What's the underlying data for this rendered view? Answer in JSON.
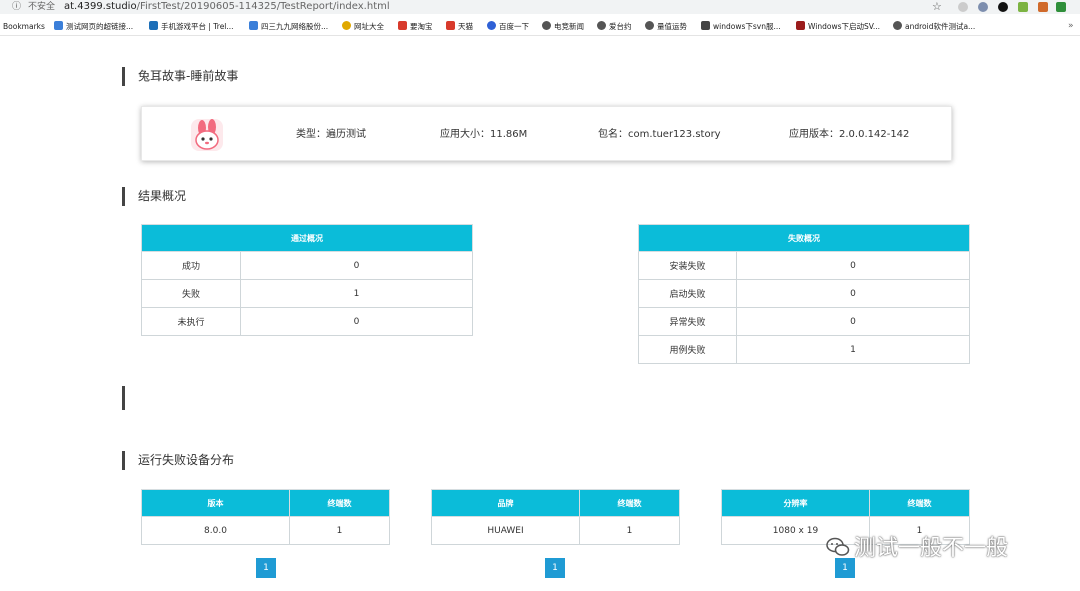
{
  "browser": {
    "security_label": "不安全",
    "url_host": "at.4399.studio",
    "url_path": "/FirstTest/20190605-114325/TestReport/index.html",
    "bookmarks_label": "Bookmarks",
    "bookmarks": [
      {
        "label": "测试网页的超链接...",
        "color": "#3b7fd9"
      },
      {
        "label": "手机游戏平台 | Trel...",
        "color": "#1d6fb8"
      },
      {
        "label": "四三九九网络股份...",
        "color": "#3b7fd9"
      },
      {
        "label": "网址大全",
        "color": "#e0a800"
      },
      {
        "label": "要淘宝",
        "color": "#d83a2c"
      },
      {
        "label": "天猫",
        "color": "#d83a2c"
      },
      {
        "label": "百度一下",
        "color": "#2f61d6"
      },
      {
        "label": "电竞新闻",
        "color": "#555555"
      },
      {
        "label": "爱台约",
        "color": "#555555"
      },
      {
        "label": "量值运势",
        "color": "#555555"
      },
      {
        "label": "windows下svn服...",
        "color": "#444444"
      },
      {
        "label": "Windows下启动SV...",
        "color": "#9b1c1c"
      },
      {
        "label": "android软件测试a...",
        "color": "#555555"
      }
    ],
    "more": "»"
  },
  "app_section": {
    "title": "兔耳故事-睡前故事",
    "type_label": "类型：遍历测试",
    "size_label": "应用大小：11.86M",
    "package_label": "包名：com.tuer123.story",
    "version_label": "应用版本：2.0.0.142-142"
  },
  "summary_section": {
    "title": "结果概况",
    "pass_table": {
      "header": "通过概况",
      "rows": [
        {
          "label": "成功",
          "value": "0"
        },
        {
          "label": "失败",
          "value": "1"
        },
        {
          "label": "未执行",
          "value": "0"
        }
      ]
    },
    "fail_table": {
      "header": "失败概况",
      "rows": [
        {
          "label": "安装失败",
          "value": "0"
        },
        {
          "label": "启动失败",
          "value": "0"
        },
        {
          "label": "异常失败",
          "value": "0"
        },
        {
          "label": "用例失败",
          "value": "1"
        }
      ]
    }
  },
  "device_section": {
    "title": "运行失败设备分布",
    "version_table": {
      "col1": "版本",
      "col2": "终端数",
      "row": {
        "c1": "8.0.0",
        "c2": "1"
      },
      "page": "1"
    },
    "brand_table": {
      "col1": "品牌",
      "col2": "终端数",
      "row": {
        "c1": "HUAWEI",
        "c2": "1"
      },
      "page": "1"
    },
    "resolution_table": {
      "col1": "分辨率",
      "col2": "终端数",
      "row": {
        "c1": "1080 x 19",
        "c2": "1"
      },
      "page": "1"
    }
  },
  "watermark": "测试一般不一般",
  "colors": {
    "accent": "#0bbcd9",
    "pager": "#1f9bd4"
  }
}
